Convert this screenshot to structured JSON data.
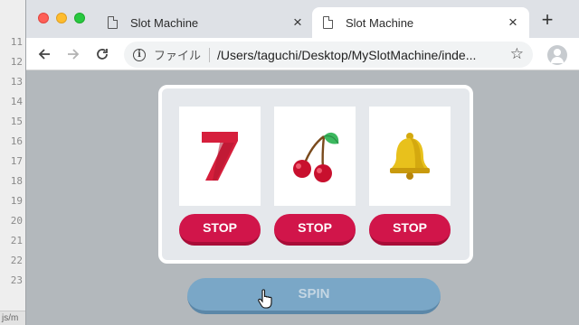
{
  "editor": {
    "line_numbers": [
      "11",
      "12",
      "13",
      "14",
      "15",
      "16",
      "17",
      "18",
      "19",
      "20",
      "21",
      "22",
      "23"
    ],
    "status_text": "js/m"
  },
  "browser": {
    "tabs": [
      {
        "title": "Slot Machine",
        "active": false
      },
      {
        "title": "Slot Machine",
        "active": true
      }
    ],
    "close_glyph": "×",
    "new_tab_glyph": "+",
    "address": {
      "scheme_label": "ファイル",
      "url": "/Users/taguchi/Desktop/MySlotMachine/inde..."
    },
    "icons": {
      "back": "arrow-left-icon",
      "forward": "arrow-right-icon",
      "reload": "reload-icon",
      "info": "info-icon",
      "bookmark": "star-icon",
      "profile": "profile-icon"
    }
  },
  "slot_machine": {
    "reels": [
      {
        "symbol": "seven",
        "stop_label": "STOP"
      },
      {
        "symbol": "cherry",
        "stop_label": "STOP"
      },
      {
        "symbol": "bell",
        "stop_label": "STOP"
      }
    ],
    "spin_label": "SPIN",
    "colors": {
      "stop_button": "#d1154a",
      "spin_button": "#7aa7c7",
      "seven": "#d61f3c",
      "cherry": "#c8102e",
      "leaf": "#3cb85f",
      "bell": "#e8c11c"
    }
  }
}
